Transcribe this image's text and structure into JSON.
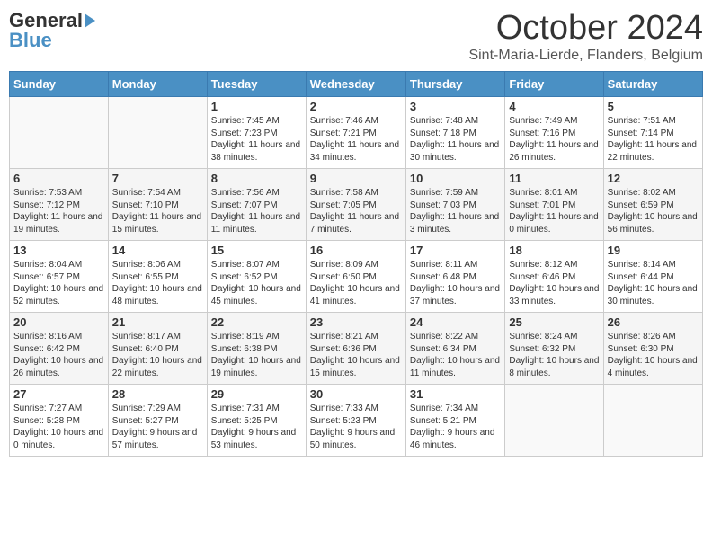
{
  "header": {
    "logo_general": "General",
    "logo_blue": "Blue",
    "month_title": "October 2024",
    "location": "Sint-Maria-Lierde, Flanders, Belgium"
  },
  "days_of_week": [
    "Sunday",
    "Monday",
    "Tuesday",
    "Wednesday",
    "Thursday",
    "Friday",
    "Saturday"
  ],
  "weeks": [
    [
      {
        "day": "",
        "sunrise": "",
        "sunset": "",
        "daylight": ""
      },
      {
        "day": "",
        "sunrise": "",
        "sunset": "",
        "daylight": ""
      },
      {
        "day": "1",
        "sunrise": "Sunrise: 7:45 AM",
        "sunset": "Sunset: 7:23 PM",
        "daylight": "Daylight: 11 hours and 38 minutes."
      },
      {
        "day": "2",
        "sunrise": "Sunrise: 7:46 AM",
        "sunset": "Sunset: 7:21 PM",
        "daylight": "Daylight: 11 hours and 34 minutes."
      },
      {
        "day": "3",
        "sunrise": "Sunrise: 7:48 AM",
        "sunset": "Sunset: 7:18 PM",
        "daylight": "Daylight: 11 hours and 30 minutes."
      },
      {
        "day": "4",
        "sunrise": "Sunrise: 7:49 AM",
        "sunset": "Sunset: 7:16 PM",
        "daylight": "Daylight: 11 hours and 26 minutes."
      },
      {
        "day": "5",
        "sunrise": "Sunrise: 7:51 AM",
        "sunset": "Sunset: 7:14 PM",
        "daylight": "Daylight: 11 hours and 22 minutes."
      }
    ],
    [
      {
        "day": "6",
        "sunrise": "Sunrise: 7:53 AM",
        "sunset": "Sunset: 7:12 PM",
        "daylight": "Daylight: 11 hours and 19 minutes."
      },
      {
        "day": "7",
        "sunrise": "Sunrise: 7:54 AM",
        "sunset": "Sunset: 7:10 PM",
        "daylight": "Daylight: 11 hours and 15 minutes."
      },
      {
        "day": "8",
        "sunrise": "Sunrise: 7:56 AM",
        "sunset": "Sunset: 7:07 PM",
        "daylight": "Daylight: 11 hours and 11 minutes."
      },
      {
        "day": "9",
        "sunrise": "Sunrise: 7:58 AM",
        "sunset": "Sunset: 7:05 PM",
        "daylight": "Daylight: 11 hours and 7 minutes."
      },
      {
        "day": "10",
        "sunrise": "Sunrise: 7:59 AM",
        "sunset": "Sunset: 7:03 PM",
        "daylight": "Daylight: 11 hours and 3 minutes."
      },
      {
        "day": "11",
        "sunrise": "Sunrise: 8:01 AM",
        "sunset": "Sunset: 7:01 PM",
        "daylight": "Daylight: 11 hours and 0 minutes."
      },
      {
        "day": "12",
        "sunrise": "Sunrise: 8:02 AM",
        "sunset": "Sunset: 6:59 PM",
        "daylight": "Daylight: 10 hours and 56 minutes."
      }
    ],
    [
      {
        "day": "13",
        "sunrise": "Sunrise: 8:04 AM",
        "sunset": "Sunset: 6:57 PM",
        "daylight": "Daylight: 10 hours and 52 minutes."
      },
      {
        "day": "14",
        "sunrise": "Sunrise: 8:06 AM",
        "sunset": "Sunset: 6:55 PM",
        "daylight": "Daylight: 10 hours and 48 minutes."
      },
      {
        "day": "15",
        "sunrise": "Sunrise: 8:07 AM",
        "sunset": "Sunset: 6:52 PM",
        "daylight": "Daylight: 10 hours and 45 minutes."
      },
      {
        "day": "16",
        "sunrise": "Sunrise: 8:09 AM",
        "sunset": "Sunset: 6:50 PM",
        "daylight": "Daylight: 10 hours and 41 minutes."
      },
      {
        "day": "17",
        "sunrise": "Sunrise: 8:11 AM",
        "sunset": "Sunset: 6:48 PM",
        "daylight": "Daylight: 10 hours and 37 minutes."
      },
      {
        "day": "18",
        "sunrise": "Sunrise: 8:12 AM",
        "sunset": "Sunset: 6:46 PM",
        "daylight": "Daylight: 10 hours and 33 minutes."
      },
      {
        "day": "19",
        "sunrise": "Sunrise: 8:14 AM",
        "sunset": "Sunset: 6:44 PM",
        "daylight": "Daylight: 10 hours and 30 minutes."
      }
    ],
    [
      {
        "day": "20",
        "sunrise": "Sunrise: 8:16 AM",
        "sunset": "Sunset: 6:42 PM",
        "daylight": "Daylight: 10 hours and 26 minutes."
      },
      {
        "day": "21",
        "sunrise": "Sunrise: 8:17 AM",
        "sunset": "Sunset: 6:40 PM",
        "daylight": "Daylight: 10 hours and 22 minutes."
      },
      {
        "day": "22",
        "sunrise": "Sunrise: 8:19 AM",
        "sunset": "Sunset: 6:38 PM",
        "daylight": "Daylight: 10 hours and 19 minutes."
      },
      {
        "day": "23",
        "sunrise": "Sunrise: 8:21 AM",
        "sunset": "Sunset: 6:36 PM",
        "daylight": "Daylight: 10 hours and 15 minutes."
      },
      {
        "day": "24",
        "sunrise": "Sunrise: 8:22 AM",
        "sunset": "Sunset: 6:34 PM",
        "daylight": "Daylight: 10 hours and 11 minutes."
      },
      {
        "day": "25",
        "sunrise": "Sunrise: 8:24 AM",
        "sunset": "Sunset: 6:32 PM",
        "daylight": "Daylight: 10 hours and 8 minutes."
      },
      {
        "day": "26",
        "sunrise": "Sunrise: 8:26 AM",
        "sunset": "Sunset: 6:30 PM",
        "daylight": "Daylight: 10 hours and 4 minutes."
      }
    ],
    [
      {
        "day": "27",
        "sunrise": "Sunrise: 7:27 AM",
        "sunset": "Sunset: 5:28 PM",
        "daylight": "Daylight: 10 hours and 0 minutes."
      },
      {
        "day": "28",
        "sunrise": "Sunrise: 7:29 AM",
        "sunset": "Sunset: 5:27 PM",
        "daylight": "Daylight: 9 hours and 57 minutes."
      },
      {
        "day": "29",
        "sunrise": "Sunrise: 7:31 AM",
        "sunset": "Sunset: 5:25 PM",
        "daylight": "Daylight: 9 hours and 53 minutes."
      },
      {
        "day": "30",
        "sunrise": "Sunrise: 7:33 AM",
        "sunset": "Sunset: 5:23 PM",
        "daylight": "Daylight: 9 hours and 50 minutes."
      },
      {
        "day": "31",
        "sunrise": "Sunrise: 7:34 AM",
        "sunset": "Sunset: 5:21 PM",
        "daylight": "Daylight: 9 hours and 46 minutes."
      },
      {
        "day": "",
        "sunrise": "",
        "sunset": "",
        "daylight": ""
      },
      {
        "day": "",
        "sunrise": "",
        "sunset": "",
        "daylight": ""
      }
    ]
  ]
}
